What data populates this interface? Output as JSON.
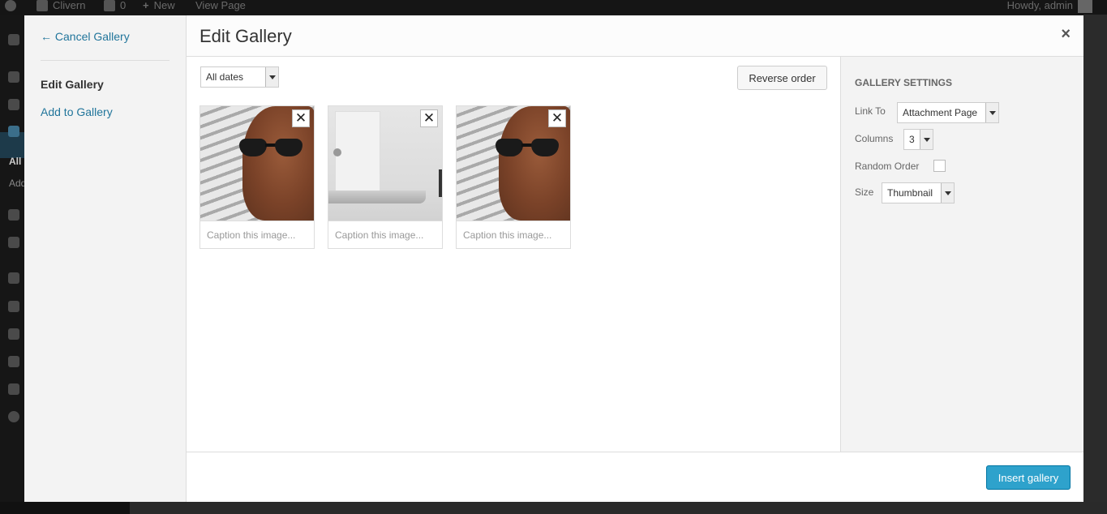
{
  "adminbar": {
    "site_name": "Clivern",
    "comments_count": "0",
    "new_label": "New",
    "view_page_label": "View Page",
    "howdy": "Howdy, admin"
  },
  "adminmenu": {
    "labels": [
      "All",
      "Add"
    ]
  },
  "modal": {
    "menu": {
      "cancel": "← Cancel Gallery",
      "edit": "Edit Gallery",
      "add": "Add to Gallery"
    },
    "title": "Edit Gallery",
    "close_glyph": "×",
    "filters": {
      "date_selected": "All dates"
    },
    "reverse_label": "Reverse order",
    "attachments": [
      {
        "caption_placeholder": "Caption this image...",
        "remove_glyph": "✕"
      },
      {
        "caption_placeholder": "Caption this image...",
        "remove_glyph": "✕"
      },
      {
        "caption_placeholder": "Caption this image...",
        "remove_glyph": "✕"
      }
    ],
    "settings": {
      "heading": "Gallery Settings",
      "link_to_label": "Link To",
      "link_to_value": "Attachment Page",
      "columns_label": "Columns",
      "columns_value": "3",
      "random_label": "Random Order",
      "size_label": "Size",
      "size_value": "Thumbnail"
    },
    "insert_label": "Insert gallery"
  },
  "colors": {
    "primary": "#2ea2cc",
    "link": "#21759b"
  }
}
